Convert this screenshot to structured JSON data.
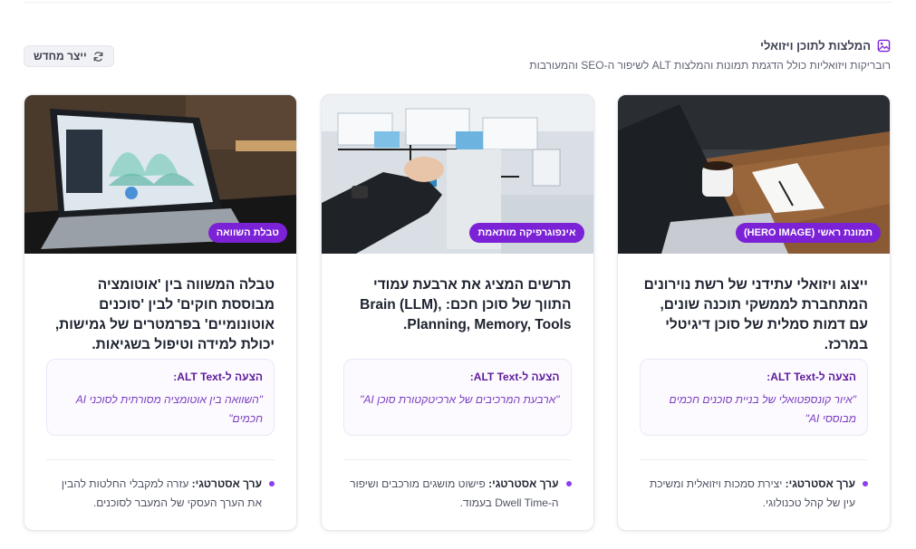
{
  "section": {
    "title": "המלצות לתוכן ויזואלי",
    "subtitle": "רובריקות ויזואליות כולל הדגמת תמונות והמלצות ALT לשיפור ה-SEO והמעורבות",
    "regenerate_label": "ייצר מחדש"
  },
  "cards": [
    {
      "badge": "תמונת ראשי (HERO IMAGE)",
      "description": "ייצוג ויזואלי עתידני של רשת נוירונים המתחברת לממשקי תוכנה שונים, עם דמות סמלית של סוכן דיגיטלי במרכז.",
      "alt_label": "הצעה ל-ALT Text:",
      "alt_text": "\"איור קונספטואלי של בניית סוכנים חכמים מבוססי AI\"",
      "strategy_label": "ערך אסטרטגי:",
      "strategy_text": "יצירת סמכות ויזואלית ומשיכת עין של קהל טכנולוגי."
    },
    {
      "badge": "אינפוגרפיקה מותאמת",
      "description": "תרשים המציג את ארבעת עמודי התווך של סוכן חכם: ,Brain (LLM) .Planning, Memory, Tools",
      "alt_label": "הצעה ל-ALT Text:",
      "alt_text": "\"ארבעת המרכיבים של ארכיטקטורת סוכן AI\"",
      "strategy_label": "ערך אסטרטגי:",
      "strategy_text": "פישוט מושגים מורכבים ושיפור ה-Dwell Time בעמוד."
    },
    {
      "badge": "טבלת השוואה",
      "description": "טבלה המשווה בין 'אוטומציה מבוססת חוקים' לבין 'סוכנים אוטונומיים' בפרמטרים של גמישות, יכולת למידה וטיפול בשגיאות.",
      "alt_label": "הצעה ל-ALT Text:",
      "alt_text": "\"השוואה בין אוטומציה מסורתית לסוכני AI חכמים\"",
      "strategy_label": "ערך אסטרטגי:",
      "strategy_text": "עזרה למקבלי החלטות להבין את הערך העסקי של המעבר לסוכנים."
    }
  ],
  "icons": {
    "section": "image-icon",
    "regenerate": "refresh-icon"
  },
  "colors": {
    "accent": "#7b22d6",
    "badge_text": "#ffffff",
    "alt_label": "#5d1a9a"
  }
}
